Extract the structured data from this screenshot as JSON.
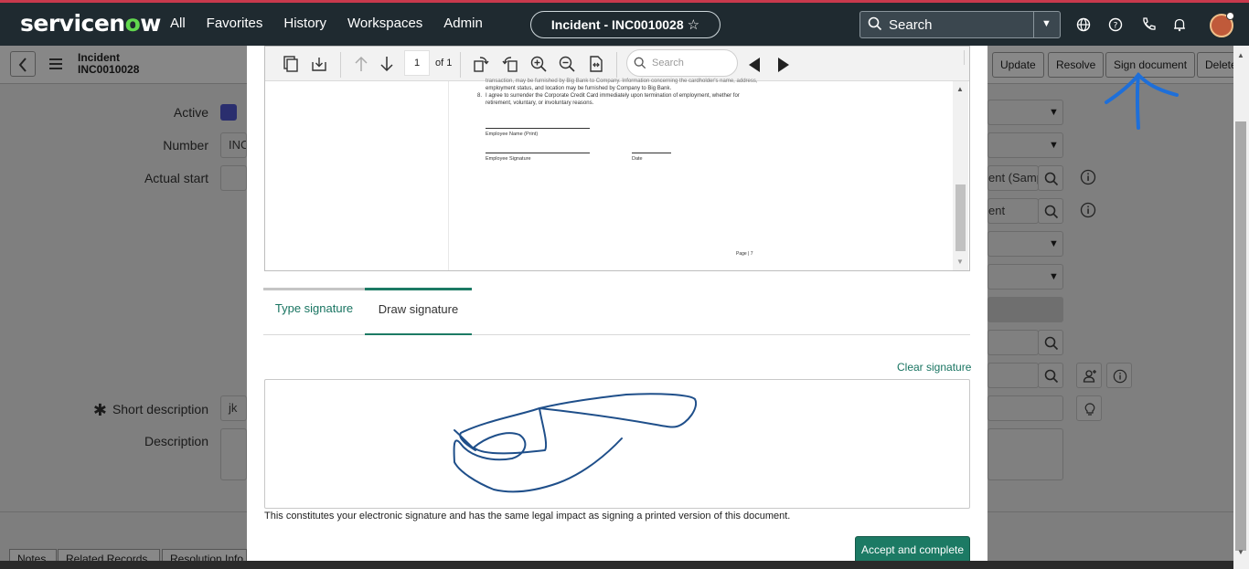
{
  "nav": {
    "logo_pre": "servicen",
    "logo_o": "o",
    "logo_post": "w",
    "links": [
      "All",
      "Favorites",
      "History",
      "Workspaces",
      "Admin"
    ],
    "context_pill": "Incident - INC0010028",
    "search_label": "Search"
  },
  "form": {
    "record_type": "Incident",
    "record_number": "INC0010028",
    "buttons": {
      "update": "Update",
      "resolve": "Resolve",
      "sign": "Sign document",
      "delete": "Delete"
    },
    "labels": {
      "active": "Active",
      "number": "Number",
      "actual_start": "Actual start",
      "short_description": "Short description",
      "description": "Description"
    },
    "number_value": "INC",
    "short_description_value": "jk",
    "caller_value": "ent (Samp",
    "category_value": "ent",
    "tabs": [
      "Notes",
      "Related Records",
      "Resolution Info"
    ]
  },
  "modal": {
    "pdf": {
      "page_number": "1",
      "page_of": "of 1",
      "search_placeholder": "Search",
      "line1": "transaction, may be furnished by Big Bank to Company. Information concerning the cardholder's name, address,",
      "line2": "employment status, and location may be furnished by Company to Big Bank.",
      "item_num": "8.",
      "line3": "I agree to surrender the Corporate Credit Card immediately upon termination of employment, whether for",
      "line4": "retirement, voluntary, or involuntary reasons.",
      "employee_name": "Employee Name (Print)",
      "employee_signature": "Employee Signature",
      "date_label": "Date",
      "page_footer": "Page | 7"
    },
    "tabs": {
      "type": "Type signature",
      "draw": "Draw signature"
    },
    "clear_signature": "Clear signature",
    "disclaimer": "This constitutes your electronic signature and has the same legal impact as signing a printed version of this document.",
    "accept_button": "Accept and complete"
  }
}
